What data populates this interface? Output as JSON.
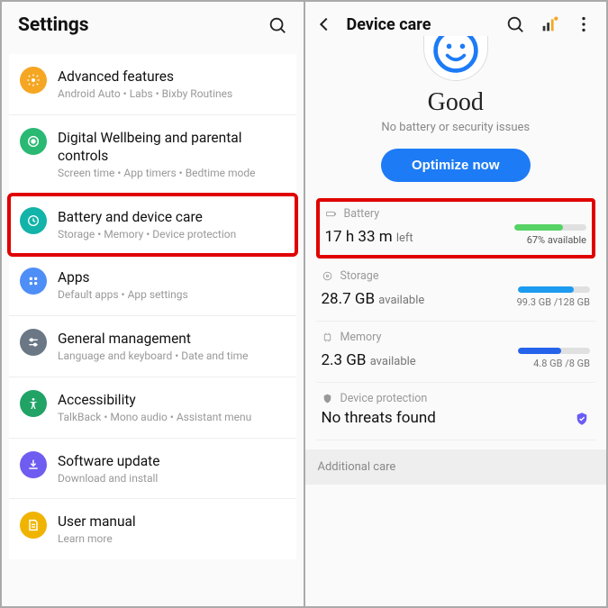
{
  "left": {
    "title": "Settings",
    "items": [
      {
        "title": "Advanced features",
        "sub": "Android Auto • Labs • Bixby Routines",
        "icon": "advanced",
        "color": "#f5a623"
      },
      {
        "title": "Digital Wellbeing and parental controls",
        "sub": "Screen time • App timers • Bedtime mode",
        "icon": "wellbeing",
        "color": "#29b973"
      },
      {
        "title": "Battery and device care",
        "sub": "Storage • Memory • Device protection",
        "icon": "care",
        "color": "#12b3a8",
        "highlight": true
      },
      {
        "title": "Apps",
        "sub": "Default apps • App settings",
        "icon": "apps",
        "color": "#4e8ef7"
      },
      {
        "title": "General management",
        "sub": "Language and keyboard • Date and time",
        "icon": "general",
        "color": "#6b7785"
      },
      {
        "title": "Accessibility",
        "sub": "TalkBack • Mono audio • Assistant menu",
        "icon": "accessibility",
        "color": "#21a366"
      },
      {
        "title": "Software update",
        "sub": "Download and install",
        "icon": "update",
        "color": "#6f5cf0"
      },
      {
        "title": "User manual",
        "sub": "Learn more",
        "icon": "manual",
        "color": "#f0b400"
      }
    ]
  },
  "right": {
    "title": "Device care",
    "status": "Good",
    "status_sub": "No battery or security issues",
    "optimize": "Optimize now",
    "battery": {
      "label": "Battery",
      "main": "17 h 33 m",
      "main_suffix": "left",
      "pct": 67,
      "pct_text": "67% available",
      "color": "#56d364"
    },
    "storage": {
      "label": "Storage",
      "main": "28.7 GB",
      "main_suffix": "available",
      "used": 99.3,
      "total": 128,
      "sub_text": "99.3 GB /128 GB",
      "pct": 78,
      "color": "#1d9bf0"
    },
    "memory": {
      "label": "Memory",
      "main": "2.3 GB",
      "main_suffix": "available",
      "used": 4.8,
      "total": 8,
      "sub_text": "4.8 GB /8 GB",
      "pct": 60,
      "color": "#2563eb"
    },
    "protection": {
      "label": "Device protection",
      "main": "No threats found"
    },
    "additional": "Additional care"
  }
}
